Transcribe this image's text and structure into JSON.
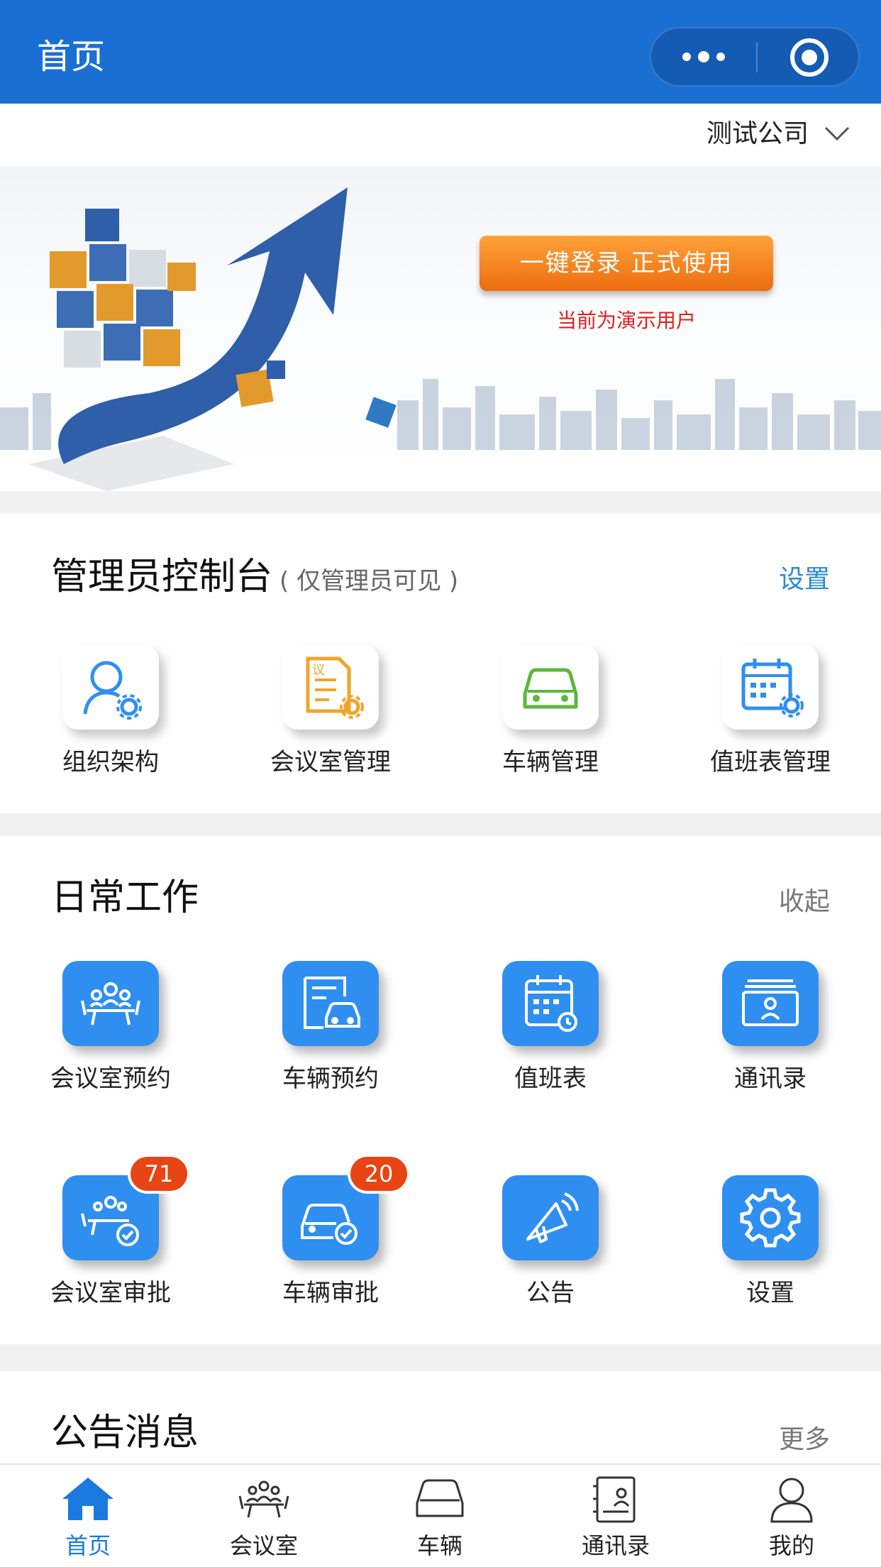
{
  "header": {
    "title": "首页"
  },
  "company": {
    "name": "测试公司"
  },
  "banner": {
    "login_button": "一键登录 正式使用",
    "demo_note": "当前为演示用户"
  },
  "admin": {
    "title": "管理员控制台",
    "subtitle": "( 仅管理员可见 )",
    "action": "设置",
    "action_color": "#2a8ad8",
    "items": [
      {
        "label": "组织架构",
        "icon": "org-user-gear-icon"
      },
      {
        "label": "会议室管理",
        "icon": "meeting-doc-icon"
      },
      {
        "label": "车辆管理",
        "icon": "car-icon"
      },
      {
        "label": "值班表管理",
        "icon": "calendar-gear-icon"
      }
    ]
  },
  "daily": {
    "title": "日常工作",
    "action": "收起",
    "items": [
      {
        "label": "会议室预约",
        "icon": "meeting-room-icon"
      },
      {
        "label": "车辆预约",
        "icon": "car-booking-icon"
      },
      {
        "label": "值班表",
        "icon": "duty-calendar-icon"
      },
      {
        "label": "通讯录",
        "icon": "contacts-icon"
      },
      {
        "label": "会议室审批",
        "icon": "meeting-approve-icon",
        "badge": "71"
      },
      {
        "label": "车辆审批",
        "icon": "car-approve-icon",
        "badge": "20"
      },
      {
        "label": "公告",
        "icon": "megaphone-icon"
      },
      {
        "label": "设置",
        "icon": "gear-icon"
      }
    ]
  },
  "notice": {
    "title": "公告消息",
    "action": "更多"
  },
  "tabbar": {
    "active_color": "#1a7ae0",
    "items": [
      {
        "label": "首页",
        "icon": "home-icon",
        "active": true
      },
      {
        "label": "会议室",
        "icon": "meeting-room-icon"
      },
      {
        "label": "车辆",
        "icon": "car-icon"
      },
      {
        "label": "通讯录",
        "icon": "contacts-icon"
      },
      {
        "label": "我的",
        "icon": "user-icon"
      }
    ]
  },
  "colors": {
    "primary": "#1a6fd3",
    "tile_blue": "#2f8ff0",
    "badge_red": "#e94414",
    "orange_button": "#f0801e"
  }
}
